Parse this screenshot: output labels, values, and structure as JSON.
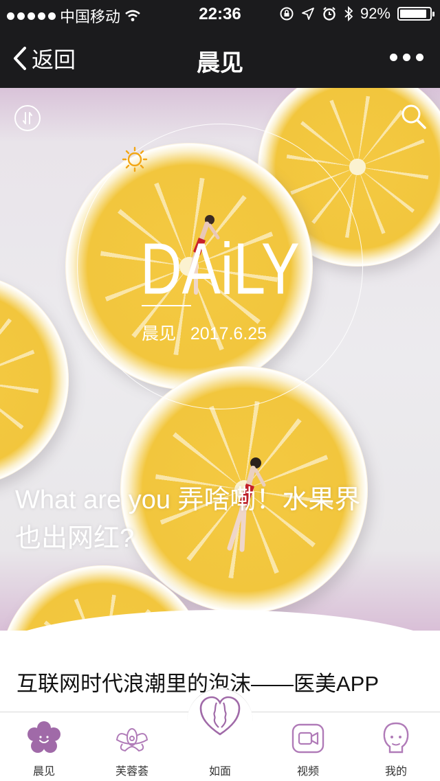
{
  "status_bar": {
    "carrier": "中国移动",
    "time": "22:36",
    "battery_text": "92%",
    "battery_level": 0.92
  },
  "nav": {
    "back_label": "返回",
    "title": "晨见"
  },
  "hero": {
    "logo_text": "DAiLY",
    "sub_label": "晨见",
    "date": "2017.6.25",
    "headline_line1": "What are you 弄啥嘞！水果界",
    "headline_line2": "也出网红?"
  },
  "article": {
    "title": "互联网时代浪潮里的泡沫——医美APP"
  },
  "tabbar": {
    "tabs": [
      {
        "label": "晨见",
        "icon": "flower-face-icon"
      },
      {
        "label": "芙蓉荟",
        "icon": "lotus-icon"
      },
      {
        "label": "如面",
        "icon": "heart-faces-icon"
      },
      {
        "label": "视频",
        "icon": "video-icon"
      },
      {
        "label": "我的",
        "icon": "person-icon"
      }
    ],
    "accent_color": "#9a5a9e"
  },
  "colors": {
    "bar_bg": "#1b1b1d",
    "accent_purple": "#9a5a9e",
    "sun_orange": "#f2a614"
  }
}
